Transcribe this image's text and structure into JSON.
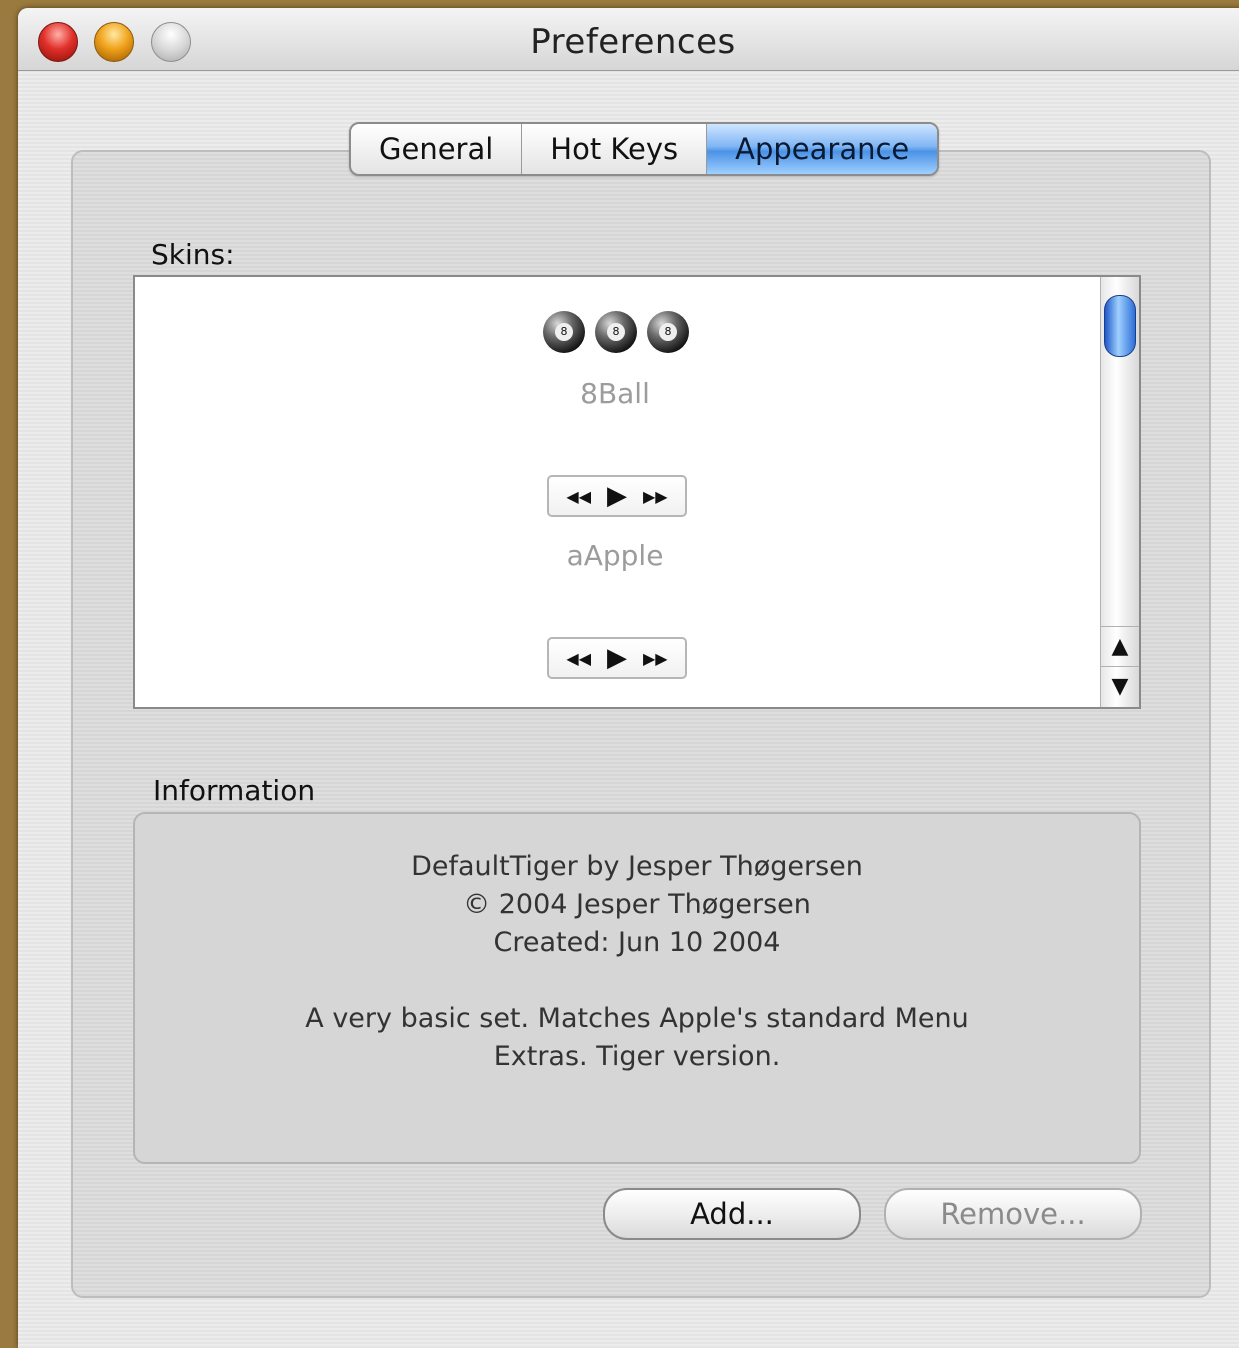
{
  "window": {
    "title": "Preferences"
  },
  "tabs": [
    {
      "label": "General",
      "active": false
    },
    {
      "label": "Hot Keys",
      "active": false
    },
    {
      "label": "Appearance",
      "active": true
    }
  ],
  "skins": {
    "label": "Skins:",
    "items": [
      {
        "name": "8Ball",
        "preview": "8ball-icons"
      },
      {
        "name": "aApple",
        "preview": "media-controls-icon"
      }
    ],
    "partial_item_preview": "media-controls-icon"
  },
  "information": {
    "label": "Information",
    "line1": "DefaultTiger by Jesper Thøgersen",
    "line2": "© 2004 Jesper Thøgersen",
    "line3": "Created: Jun 10 2004",
    "description_line1": "A very basic set. Matches Apple's standard Menu",
    "description_line2": "Extras. Tiger version."
  },
  "buttons": {
    "add": "Add...",
    "remove": "Remove..."
  },
  "colors": {
    "accent": "#4b92e6",
    "desktop": "#9a7a3e"
  }
}
